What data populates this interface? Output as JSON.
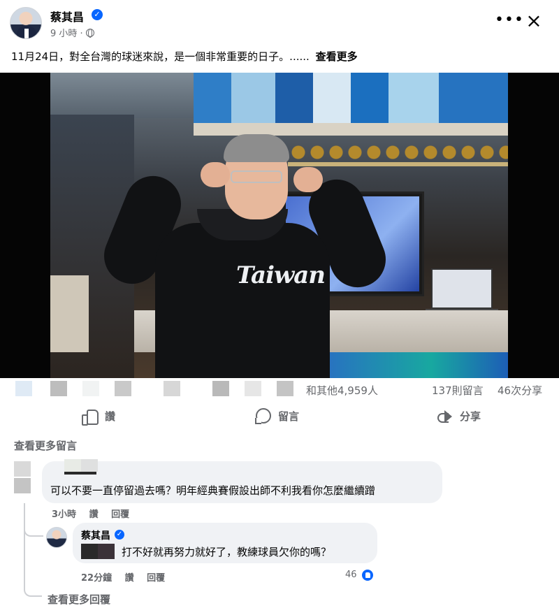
{
  "post": {
    "author": "蔡其昌",
    "meta_time": "9 小時 ·",
    "text": "11月24日，對全台灣的球迷來說，是一個非常重要的日子。......",
    "see_more": "查看更多"
  },
  "photo": {
    "hoodie_text": "Taiwan"
  },
  "stats": {
    "reactions": "和其他4,959人",
    "comments": "137則留言",
    "shares": "46次分享"
  },
  "actions": {
    "like": "讚",
    "comment": "留言",
    "share": "分享"
  },
  "view_more_comments": "查看更多留言",
  "comment1": {
    "text": "可以不要一直停留過去嗎？明年經典賽假設出師不利我看你怎麼繼續蹭",
    "time": "3小時",
    "like": "讚",
    "reply": "回覆"
  },
  "reply1": {
    "author": "蔡其昌",
    "text": "打不好就再努力就好了，教練球員欠你的嗎？",
    "time": "22分鐘",
    "like": "讚",
    "reply": "回覆",
    "like_count": "46"
  },
  "view_more_replies": "查看更多回覆",
  "colors": {
    "accent": "#0866ff",
    "secondary_text": "#65676b",
    "bubble": "#f0f2f5"
  }
}
